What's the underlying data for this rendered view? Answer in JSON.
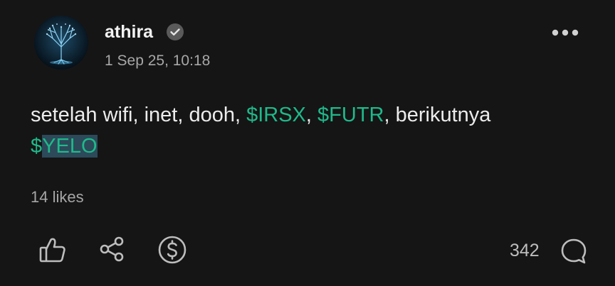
{
  "post": {
    "author": "athira",
    "timestamp": "1 Sep 25, 10:18",
    "text_parts": {
      "p1": "setelah wifi, inet, dooh, ",
      "t1": "$IRSX",
      "p2": ", ",
      "t2": "$FUTR",
      "p3": ", berikutnya",
      "t3_prefix": "$",
      "t3_rest": "YELO"
    },
    "likes": "14 likes",
    "comment_count": "342"
  },
  "icons": {
    "avatar": "tree-avatar",
    "verified": "verified-check-icon",
    "more": "more-dots-icon",
    "like": "thumbs-up-icon",
    "share": "share-icon",
    "tip": "dollar-coin-icon",
    "comment": "comment-bubble-icon"
  },
  "colors": {
    "background": "#151515",
    "ticker": "#1fb98a",
    "highlight": "#2c4a5a"
  }
}
